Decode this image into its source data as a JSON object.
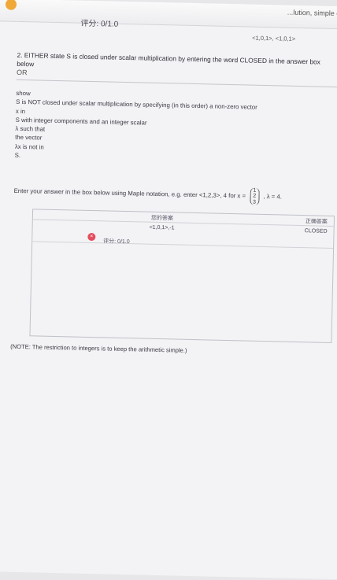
{
  "header": {
    "score": "评分: 0/1.0",
    "top_right_partial": "...lution, simple co"
  },
  "answer_preview": "<1,0,1>, <1,0,1>",
  "question": {
    "text": "2. EITHER state S is closed under scalar multiplication by entering the word CLOSED in the answer box below",
    "or_label": "OR",
    "show_lines": [
      "show",
      "S is NOT closed under scalar multiplication by specifying (in this order) a non-zero vector",
      "x in",
      "S with integer components and an integer scalar",
      "λ such that",
      "the vector",
      "λx is not in",
      "S."
    ],
    "instruction": "Enter your answer in the box below using Maple notation, e.g. enter <1,2,3>, 4 for x =",
    "example_vector": [
      "1",
      "2",
      "3"
    ],
    "example_lambda": ", λ = 4."
  },
  "answers": {
    "your_answer_label": "您的答案",
    "correct_answer_label": "正确答案",
    "your_answer": "<1,0,1>,-1",
    "correct_answer": "CLOSED",
    "score": "评分: 0/1.0",
    "status_icon": "close-icon"
  },
  "note": "(NOTE: The restriction to integers is to keep the arithmetic simple.)"
}
